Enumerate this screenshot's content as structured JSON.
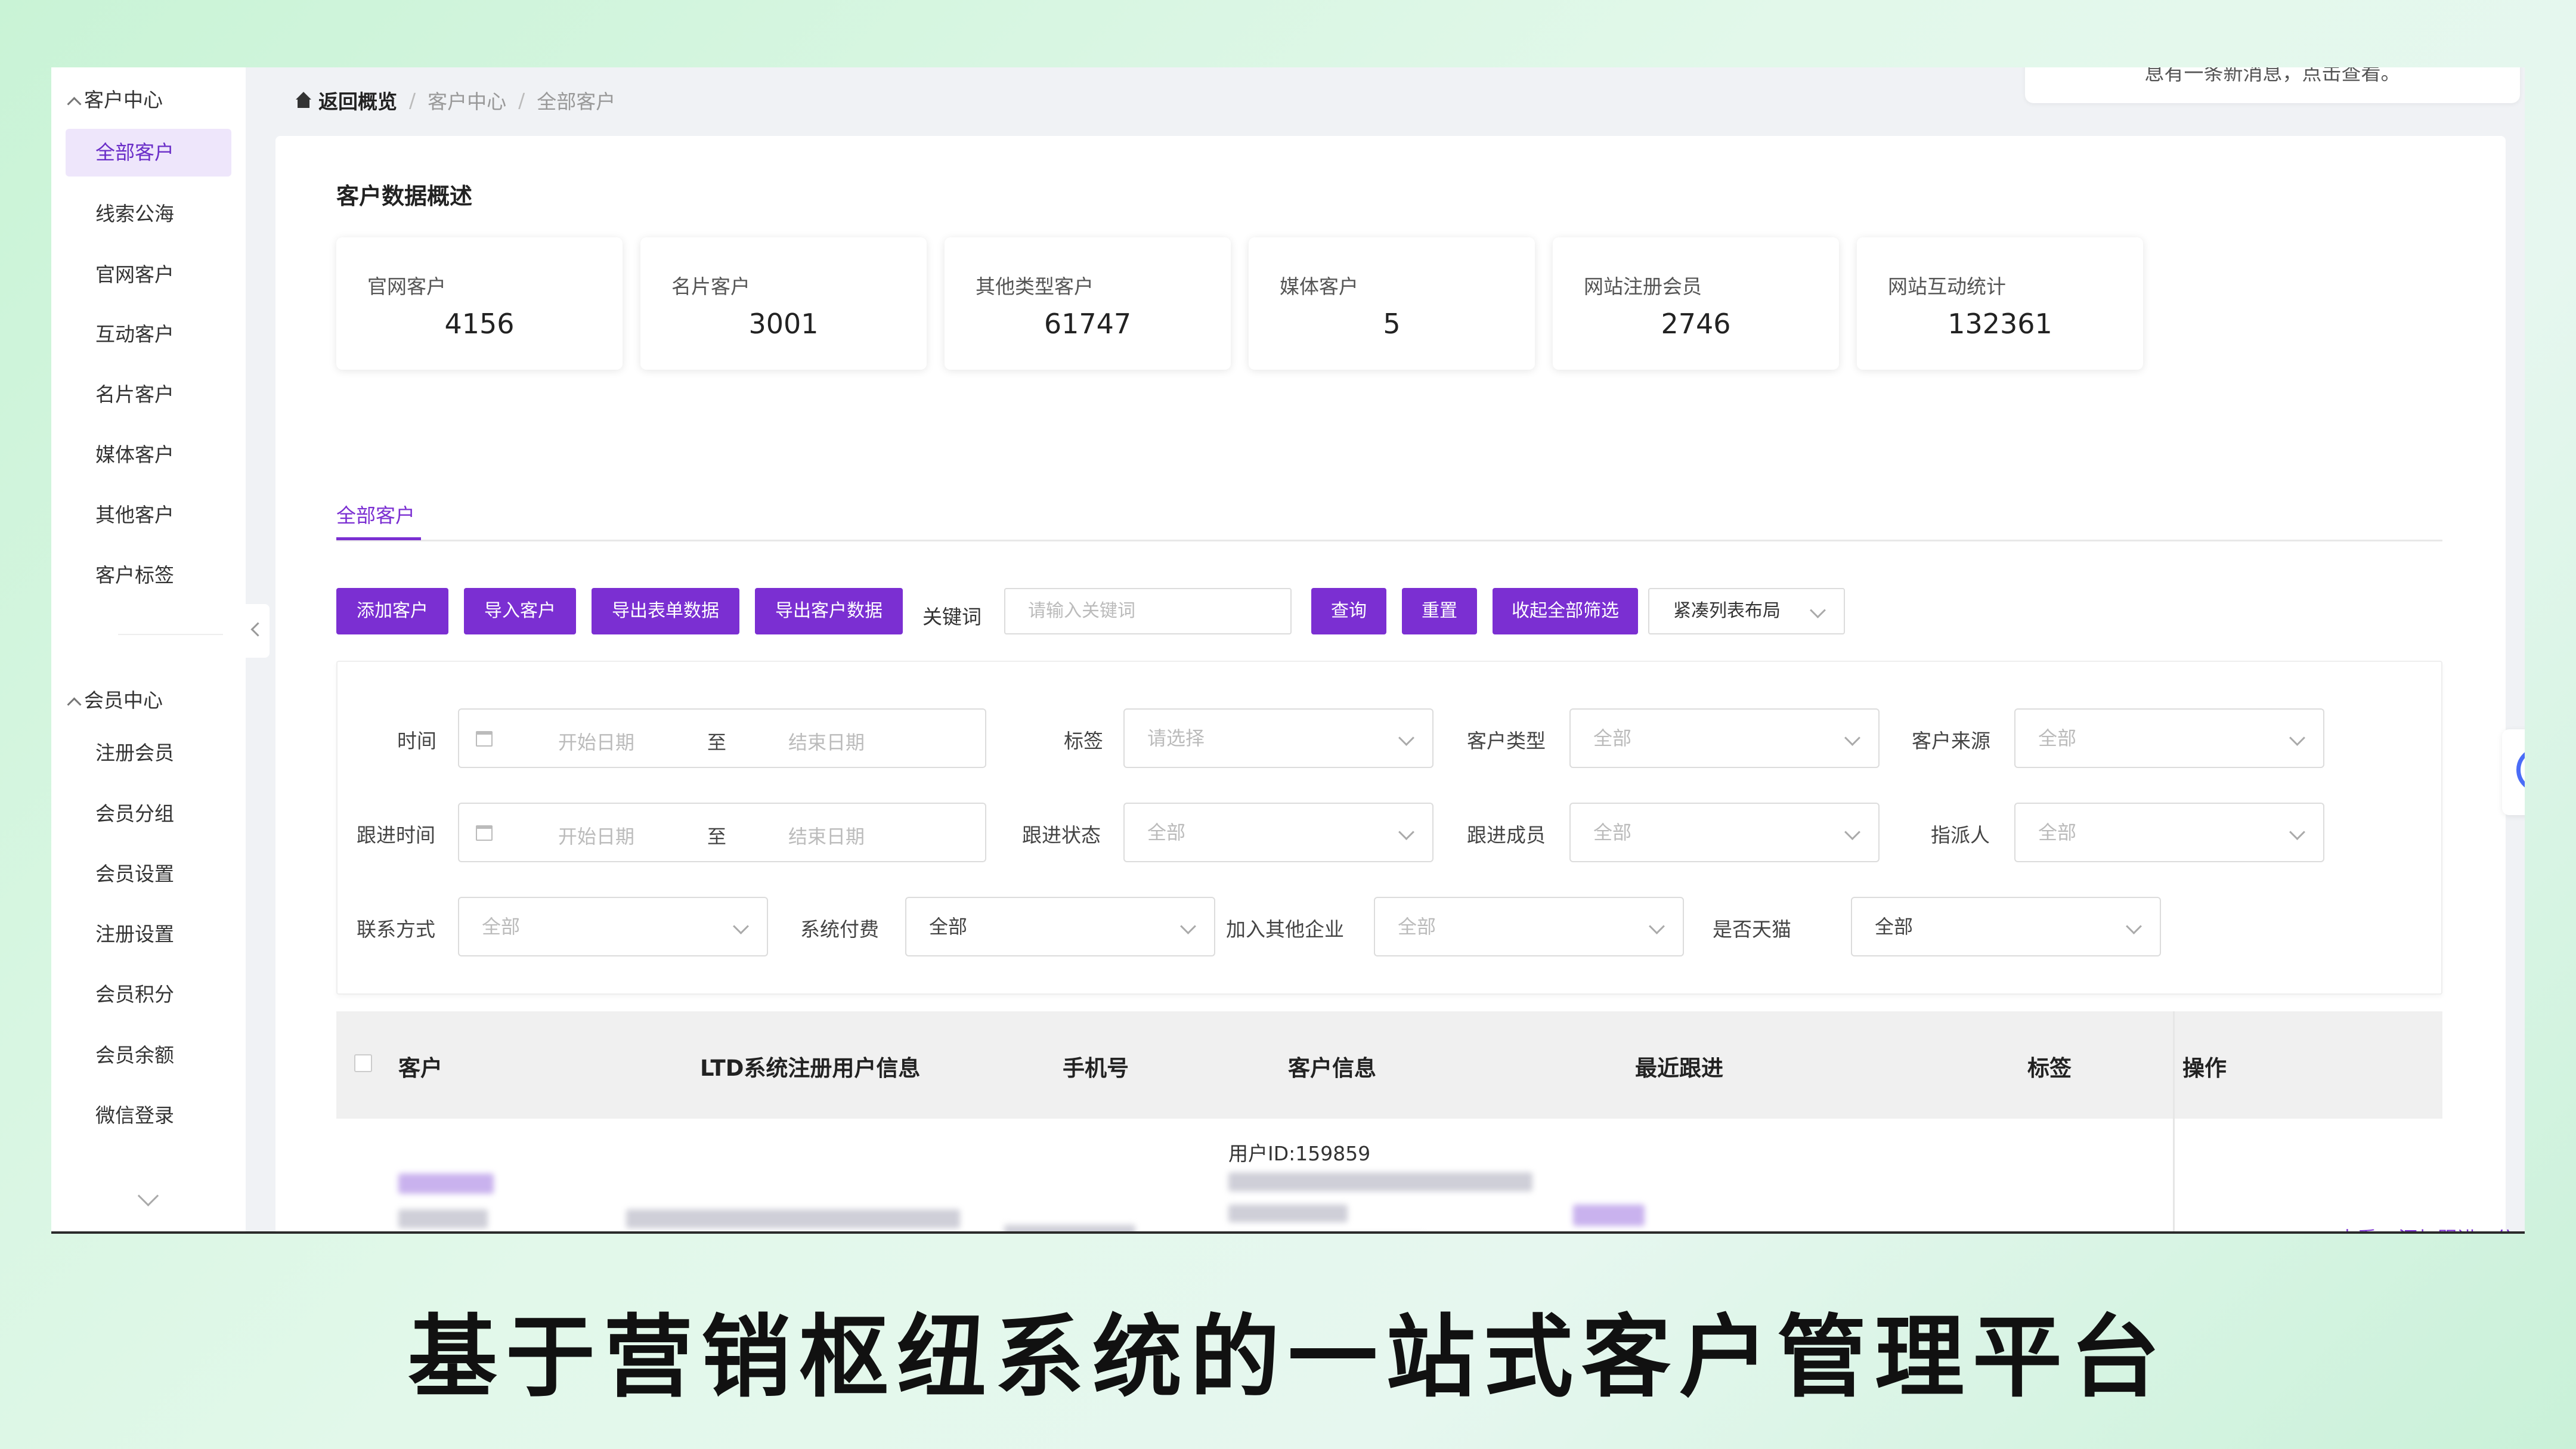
{
  "sidebar": {
    "group1": "客户中心",
    "group1_items": [
      "全部客户",
      "线索公海",
      "官网客户",
      "互动客户",
      "名片客户",
      "媒体客户",
      "其他客户",
      "客户标签"
    ],
    "group2": "会员中心",
    "group2_items": [
      "注册会员",
      "会员分组",
      "会员设置",
      "注册设置",
      "会员积分",
      "会员余额",
      "微信登录"
    ]
  },
  "breadcrumb": {
    "home": "返回概览",
    "level1": "客户中心",
    "level2": "全部客户"
  },
  "notice": "息有一条新消息，点击查看。",
  "overview": {
    "title": "客户数据概述",
    "stats": [
      {
        "label": "官网客户",
        "value": "4156"
      },
      {
        "label": "名片客户",
        "value": "3001"
      },
      {
        "label": "其他类型客户",
        "value": "61747"
      },
      {
        "label": "媒体客户",
        "value": "5"
      },
      {
        "label": "网站注册会员",
        "value": "2746"
      },
      {
        "label": "网站互动统计",
        "value": "132361"
      }
    ]
  },
  "tab": "全部客户",
  "toolbar": {
    "add": "添加客户",
    "import": "导入客户",
    "export_form": "导出表单数据",
    "export_customer": "导出客户数据",
    "keyword_label": "关键词",
    "keyword_placeholder": "请输入关键词",
    "query": "查询",
    "reset": "重置",
    "collapse": "收起全部筛选",
    "layout": "紧凑列表布局"
  },
  "filters": {
    "time": "时间",
    "start": "开始日期",
    "to": "至",
    "end": "结束日期",
    "tag": "标签",
    "tag_ph": "请选择",
    "customer_type": "客户类型",
    "all": "全部",
    "source": "客户来源",
    "follow_time": "跟进时间",
    "follow_status": "跟进状态",
    "follow_member": "跟进成员",
    "assignee": "指派人",
    "contact": "联系方式",
    "sys_pay": "系统付费",
    "join_other": "加入其他企业",
    "tmall": "是否天猫"
  },
  "table": {
    "headers": [
      "客户",
      "LTD系统注册用户信息",
      "手机号",
      "客户信息",
      "最近跟进",
      "标签",
      "操作"
    ],
    "row": {
      "user_id": "用户ID:159859",
      "tag": "--",
      "actions": [
        "查看",
        "添加跟进",
        "分配"
      ]
    }
  },
  "caption": "基于营销枢纽系统的一站式客户管理平台",
  "colors": {
    "accent": "#7b2fd2",
    "support": "#4a6cf7"
  }
}
